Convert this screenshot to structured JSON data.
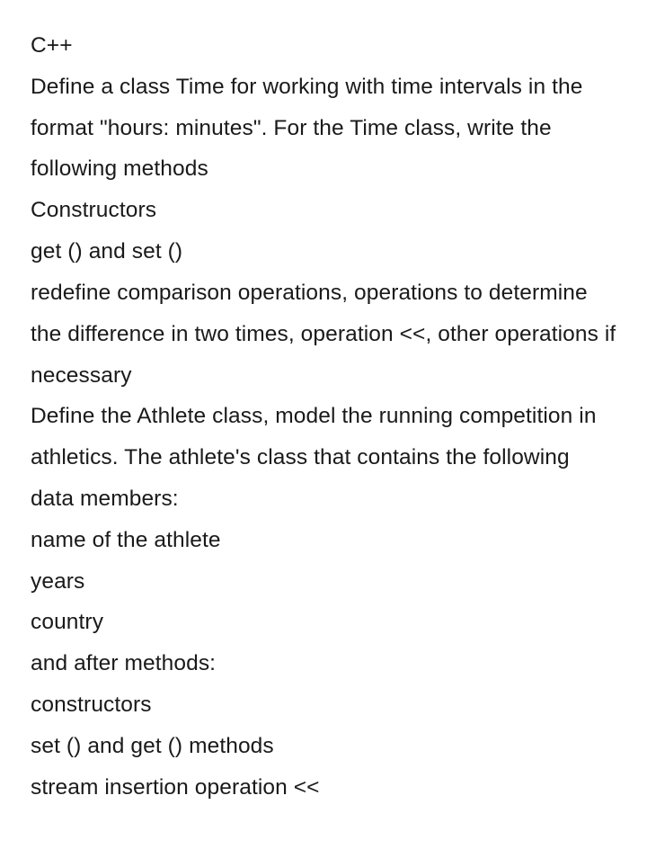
{
  "lines": {
    "l0": "C++",
    "l1": "Define a class Time for working with time intervals in the format \"hours: minutes\". For the Time class, write the following methods",
    "l2": "Constructors",
    "l3": "get () and set ()",
    "l4": "redefine comparison operations, operations to determine the difference in two times, operation <<, other operations if necessary",
    "l5": "Define the Athlete class, model the running competition in athletics. The athlete's class that contains the following data members:",
    "l6": "name of the athlete",
    "l7": "years",
    "l8": "country",
    "l9": "and after methods:",
    "l10": "constructors",
    "l11": "set () and get () methods",
    "l12": "stream insertion operation <<"
  }
}
